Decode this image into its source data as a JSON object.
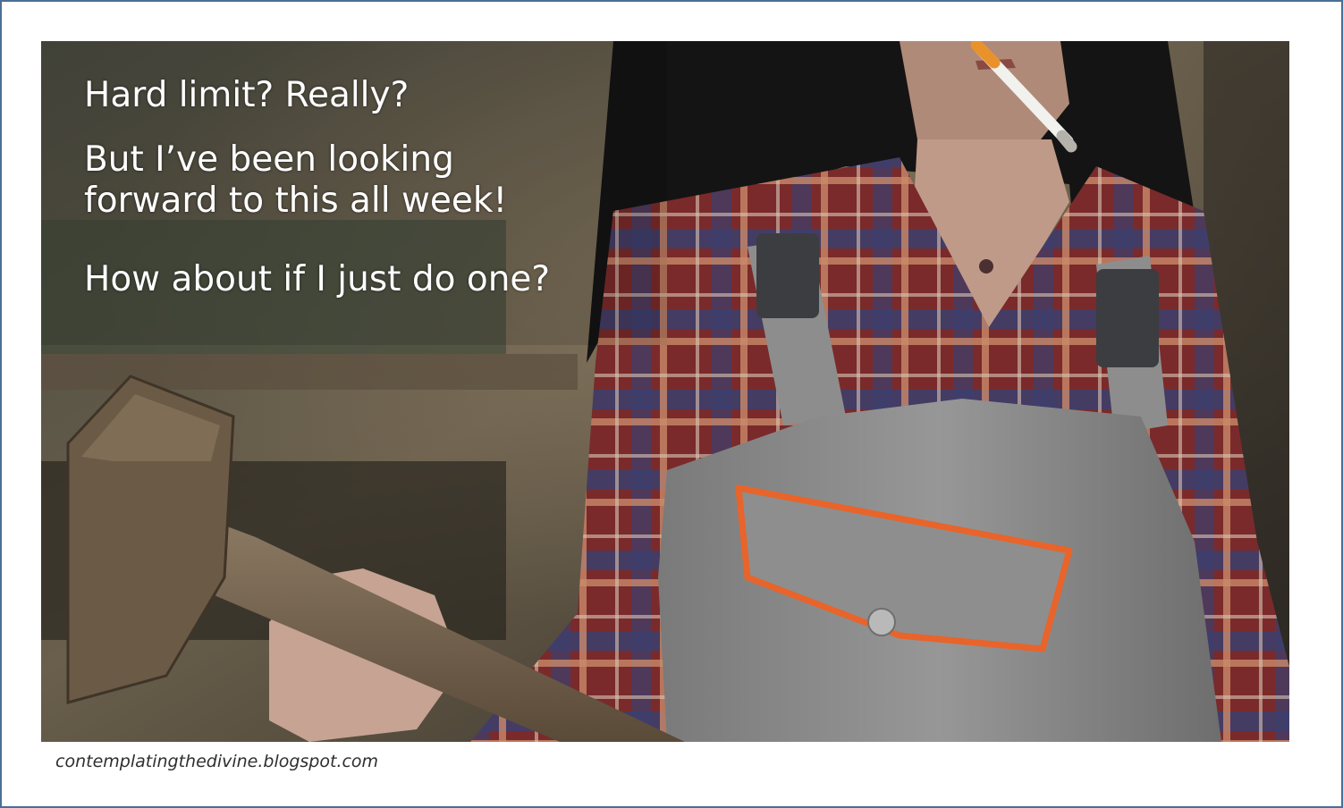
{
  "caption": {
    "line1": "Hard limit? Really?",
    "line2a": "But I’ve been looking",
    "line2b": "forward to this all week!",
    "line3": "How about if I just do one?"
  },
  "credit": "contemplatingthedivine.blogspot.com",
  "colors": {
    "frame_border": "#4a6f95",
    "overalls": "#8c8c8c",
    "pocket_trim": "#e8642a",
    "shirt_red": "#7a2a2a",
    "shirt_blue": "#3c3f6e",
    "hair": "#141414",
    "hammer_wood": "#6b5a45"
  },
  "scene": {
    "image_label": "woman-in-overalls-with-sledgehammer-photo"
  }
}
